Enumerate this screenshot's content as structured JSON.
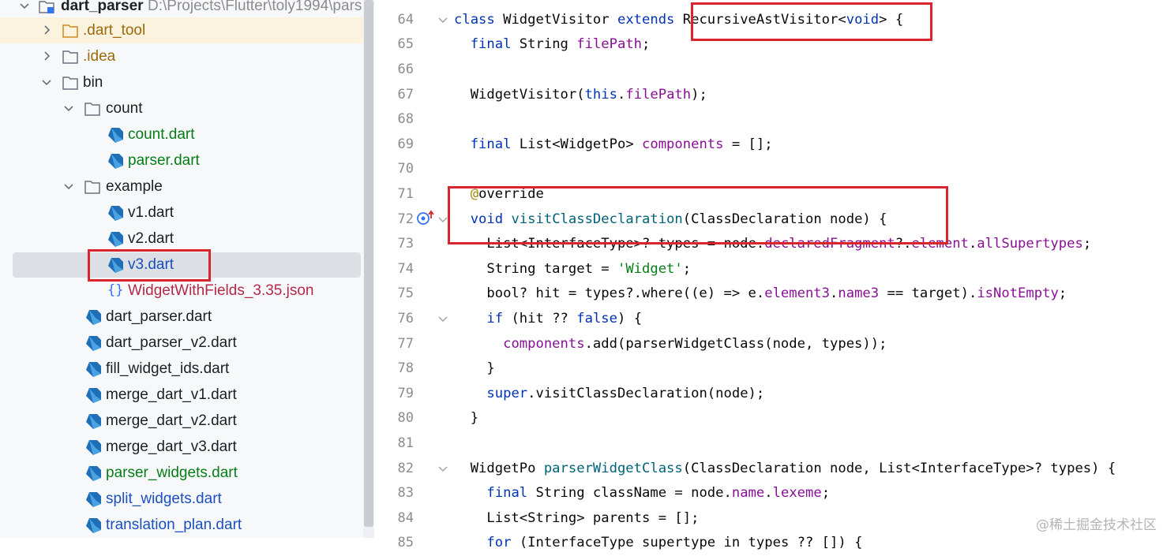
{
  "tree": {
    "root": {
      "label": "dart_parser",
      "path": "D:\\Projects\\Flutter\\toly1994\\pars"
    },
    "items": [
      {
        "label": ".dart_tool"
      },
      {
        "label": ".idea"
      },
      {
        "label": "bin"
      },
      {
        "label": "count"
      },
      {
        "label": "count.dart"
      },
      {
        "label": "parser.dart"
      },
      {
        "label": "example"
      },
      {
        "label": "v1.dart"
      },
      {
        "label": "v2.dart"
      },
      {
        "label": "v3.dart"
      },
      {
        "label": "WidgetWithFields_3.35.json"
      },
      {
        "label": "dart_parser.dart"
      },
      {
        "label": "dart_parser_v2.dart"
      },
      {
        "label": "fill_widget_ids.dart"
      },
      {
        "label": "merge_dart_v1.dart"
      },
      {
        "label": "merge_dart_v2.dart"
      },
      {
        "label": "merge_dart_v3.dart"
      },
      {
        "label": "parser_widgets.dart"
      },
      {
        "label": "split_widgets.dart"
      },
      {
        "label": "translation_plan.dart"
      }
    ]
  },
  "editor": {
    "lines": [
      {
        "num": "64",
        "tokens": [
          {
            "t": "class ",
            "c": "kw"
          },
          {
            "t": "WidgetVisitor ",
            "c": ""
          },
          {
            "t": "extends ",
            "c": "kw"
          },
          {
            "t": "RecursiveAstVisitor<",
            "c": ""
          },
          {
            "t": "void",
            "c": "kw"
          },
          {
            "t": "> {",
            "c": ""
          }
        ]
      },
      {
        "num": "65",
        "tokens": [
          {
            "t": "  ",
            "c": ""
          },
          {
            "t": "final ",
            "c": "kw"
          },
          {
            "t": "String ",
            "c": ""
          },
          {
            "t": "filePath",
            "c": "fld"
          },
          {
            "t": ";",
            "c": ""
          }
        ]
      },
      {
        "num": "66",
        "tokens": []
      },
      {
        "num": "67",
        "tokens": [
          {
            "t": "  WidgetVisitor(",
            "c": ""
          },
          {
            "t": "this",
            "c": "kw"
          },
          {
            "t": ".",
            "c": ""
          },
          {
            "t": "filePath",
            "c": "fld"
          },
          {
            "t": ");",
            "c": ""
          }
        ]
      },
      {
        "num": "68",
        "tokens": []
      },
      {
        "num": "69",
        "tokens": [
          {
            "t": "  ",
            "c": ""
          },
          {
            "t": "final ",
            "c": "kw"
          },
          {
            "t": "List<WidgetPo> ",
            "c": ""
          },
          {
            "t": "components",
            "c": "fld"
          },
          {
            "t": " = [];",
            "c": ""
          }
        ]
      },
      {
        "num": "70",
        "tokens": []
      },
      {
        "num": "71",
        "tokens": [
          {
            "t": "  ",
            "c": ""
          },
          {
            "t": "@",
            "c": "ann"
          },
          {
            "t": "override",
            "c": ""
          }
        ]
      },
      {
        "num": "72",
        "tokens": [
          {
            "t": "  ",
            "c": ""
          },
          {
            "t": "void ",
            "c": "kw"
          },
          {
            "t": "visitClassDeclaration",
            "c": "fn"
          },
          {
            "t": "(ClassDeclaration node) {",
            "c": ""
          }
        ]
      },
      {
        "num": "73",
        "tokens": [
          {
            "t": "    List<InterfaceType>? types = node.",
            "c": ""
          },
          {
            "t": "declaredFragment",
            "c": "fld"
          },
          {
            "t": "?.",
            "c": ""
          },
          {
            "t": "element",
            "c": "fld"
          },
          {
            "t": ".",
            "c": ""
          },
          {
            "t": "allSupertypes",
            "c": "fld"
          },
          {
            "t": ";",
            "c": ""
          }
        ]
      },
      {
        "num": "74",
        "tokens": [
          {
            "t": "    String target = ",
            "c": ""
          },
          {
            "t": "'Widget'",
            "c": "str"
          },
          {
            "t": ";",
            "c": ""
          }
        ]
      },
      {
        "num": "75",
        "tokens": [
          {
            "t": "    bool? hit = types?.where((e) => e.",
            "c": ""
          },
          {
            "t": "element3",
            "c": "fld"
          },
          {
            "t": ".",
            "c": ""
          },
          {
            "t": "name3",
            "c": "fld"
          },
          {
            "t": " == target).",
            "c": ""
          },
          {
            "t": "isNotEmpty",
            "c": "fld"
          },
          {
            "t": ";",
            "c": ""
          }
        ]
      },
      {
        "num": "76",
        "tokens": [
          {
            "t": "    ",
            "c": ""
          },
          {
            "t": "if ",
            "c": "kw"
          },
          {
            "t": "(hit ?? ",
            "c": ""
          },
          {
            "t": "false",
            "c": "kw"
          },
          {
            "t": ") {",
            "c": ""
          }
        ]
      },
      {
        "num": "77",
        "tokens": [
          {
            "t": "      ",
            "c": ""
          },
          {
            "t": "components",
            "c": "fld"
          },
          {
            "t": ".add(parserWidgetClass(node, types));",
            "c": ""
          }
        ]
      },
      {
        "num": "78",
        "tokens": [
          {
            "t": "    }",
            "c": ""
          }
        ]
      },
      {
        "num": "79",
        "tokens": [
          {
            "t": "    ",
            "c": ""
          },
          {
            "t": "super",
            "c": "kw"
          },
          {
            "t": ".visitClassDeclaration(node);",
            "c": ""
          }
        ]
      },
      {
        "num": "80",
        "tokens": [
          {
            "t": "  }",
            "c": ""
          }
        ]
      },
      {
        "num": "81",
        "tokens": []
      },
      {
        "num": "82",
        "tokens": [
          {
            "t": "  WidgetPo ",
            "c": ""
          },
          {
            "t": "parserWidgetClass",
            "c": "fn"
          },
          {
            "t": "(ClassDeclaration node, List<InterfaceType>? types) {",
            "c": ""
          }
        ]
      },
      {
        "num": "83",
        "tokens": [
          {
            "t": "    ",
            "c": ""
          },
          {
            "t": "final ",
            "c": "kw"
          },
          {
            "t": "String className = node.",
            "c": ""
          },
          {
            "t": "name",
            "c": "fld"
          },
          {
            "t": ".",
            "c": ""
          },
          {
            "t": "lexeme",
            "c": "fld"
          },
          {
            "t": ";",
            "c": ""
          }
        ]
      },
      {
        "num": "84",
        "tokens": [
          {
            "t": "    List<String> parents = [];",
            "c": ""
          }
        ]
      },
      {
        "num": "85",
        "tokens": [
          {
            "t": "    ",
            "c": ""
          },
          {
            "t": "for ",
            "c": "kw"
          },
          {
            "t": "(InterfaceType supertype in types ?? []) {",
            "c": ""
          }
        ]
      }
    ]
  },
  "watermark": "@稀土掘金技术社区",
  "colors": {
    "highlight_box": "#d9262e",
    "selection": "#dcdfe4",
    "folder_highlight": "#fbf3de"
  }
}
